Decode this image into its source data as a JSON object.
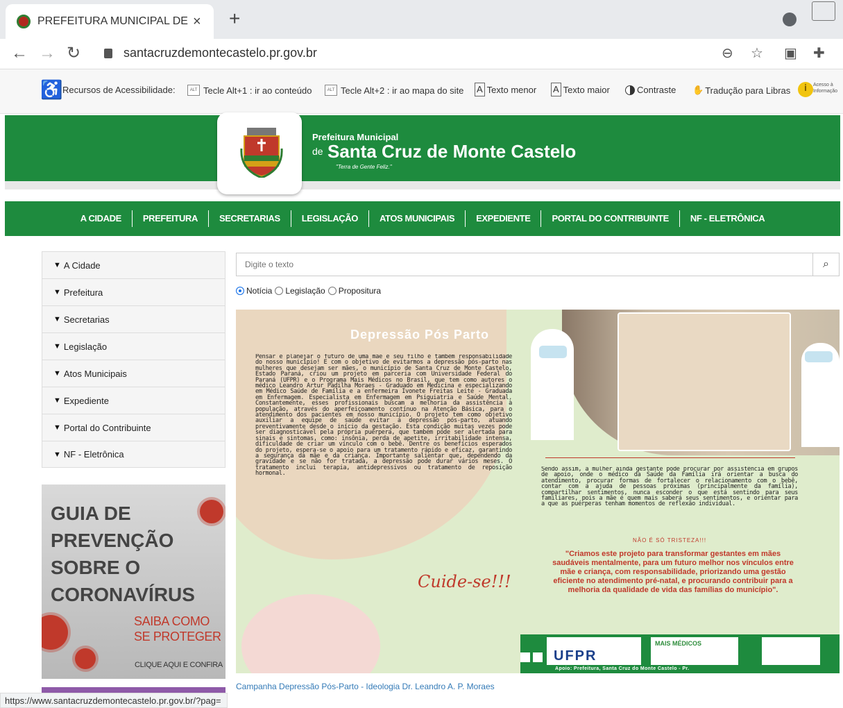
{
  "browser": {
    "tab_title": "PREFEITURA MUNICIPAL DE SAN",
    "close_glyph": "×",
    "new_tab_glyph": "+",
    "url": "santacruzdemontecastelo.pr.gov.br",
    "status_url": "https://www.santacruzdemontecastelo.pr.gov.br/?pag="
  },
  "accessibility": {
    "label": "Recursos de Acessibilidade:",
    "key1_icon": "ALT",
    "key1": "Tecle Alt+1 : ir ao conteúdo",
    "key2_icon": "ALT",
    "key2": "Tecle Alt+2 : ir ao mapa do site",
    "smaller_icon": "A",
    "smaller": "Texto menor",
    "bigger_icon": "A",
    "bigger": "Texto maior",
    "contrast": "Contraste",
    "libras": "Tradução para Libras",
    "info": "Acesso à Informação",
    "info_glyph": "i"
  },
  "header": {
    "small": "Prefeitura Municipal",
    "de": "de",
    "city": "Santa Cruz de Monte Castelo",
    "motto": "\"Terra de Gente Feliz.\""
  },
  "menu": [
    "A CIDADE",
    "PREFEITURA",
    "SECRETARIAS",
    "LEGISLAÇÃO",
    "ATOS MUNICIPAIS",
    "EXPEDIENTE",
    "PORTAL DO CONTRIBUINTE",
    "NF - ELETRÔNICA"
  ],
  "sidebar": [
    "A Cidade",
    "Prefeitura",
    "Secretarias",
    "Legislação",
    "Atos Municipais",
    "Expediente",
    "Portal do Contribuinte",
    "NF - Eletrônica"
  ],
  "covid": {
    "line1": "GUIA DE",
    "line2": "PREVENÇÃO",
    "line3": "SOBRE O",
    "line4": "CORONAVÍRUS",
    "saiba1": "SAIBA COMO",
    "saiba2": "SE PROTEGER",
    "clique": "CLIQUE AQUI E CONFIRA"
  },
  "search": {
    "placeholder": "Digite o texto",
    "options": [
      "Notícia",
      "Legislação",
      "Propositura"
    ],
    "selected": "Notícia"
  },
  "poster": {
    "title": "Depressão Pós Parto",
    "text1": "Pensar e planejar o futuro de uma mãe e seu filho é também responsabilidade do nosso município! E com o objetivo de evitarmos a depressão pós-parto nas mulheres que desejam ser mães, o município de Santa Cruz de Monte Castelo, Estado Paraná, criou um projeto em parceria com Universidade Federal do Paraná (UFPR) e o Programa Mais Médicos no Brasil, que tem como autores o médico Leandro Artur Padilha Moraes - Graduado em Medicina e especializando em Médico Saúde de Família e a enfermeira Ivonete Freitas Leite - Graduada em Enfermagem. Especialista em Enfermagem em Psiquiatria e Saúde Mental. Constantemente, esses profissionais buscam a melhoria da assistência à população, através do aperfeiçoamento contínuo na Atenção Básica, para o atendimento dos pacientes em nosso município. O projeto tem como objetivo auxiliar a equipe de saúde evitar a depressão pós-parto, atuando preventivamente desde o início da gestação. Esta condição muitas vezes pode ser diagnosticável pela própria puérpera, que também pode ser alertada para sinais e sintomas, como: insônia, perda de apetite, irritabilidade intensa, dificuldade de criar um vínculo com o bebê. Dentre os benefícios esperados do projeto, espera-se o apoio para um tratamento rápido e eficaz, garantindo a segurança da mãe e da criança. Importante salientar que, dependendo da gravidade e se não for tratada, a depressão pode durar vários meses. O tratamento inclui terapia, antidepressivos ou tratamento de reposição hormonal.",
    "text2": "Sendo assim, a mulher ainda gestante pode procurar por assistência em grupos de apoio, onde o médico da Saúde da Família irá orientar a busca do atendimento, procurar formas de fortalecer o relacionamento com o bebê, contar com a ajuda de pessoas próximas (principalmente da família), compartilhar sentimentos, nunca esconder o que está sentindo para seus familiares, pois a mãe é quem mais saberá seus sentimentos, e orientar para a que as puérperas tenham momentos de reflexão individual.",
    "nao": "NÃO É SÓ TRISTEZA!!!",
    "quote": "\"Criamos este projeto para transformar gestantes em mães saudáveis mentalmente, para um futuro melhor nos vínculos entre mãe e criança, com responsabilidade, priorizando uma gestão eficiente no atendimento pré-natal, e procurando contribuir para a melhoria da qualidade de vida das famílias do município\".",
    "cuide": "Cuide-se!!!",
    "ufpr": "UFPR",
    "mais": "MAIS MÉDICOS",
    "apoio": "Apoio: Prefeitura, Santa Cruz do Monte Castelo - Pr."
  },
  "caption": "Campanha Depressão Pós-Parto - Ideologia Dr. Leandro A. P. Moraes",
  "colors": {
    "brand_green": "#1e8b3e",
    "accent_red": "#c0392b",
    "link_blue": "#337ab7"
  }
}
